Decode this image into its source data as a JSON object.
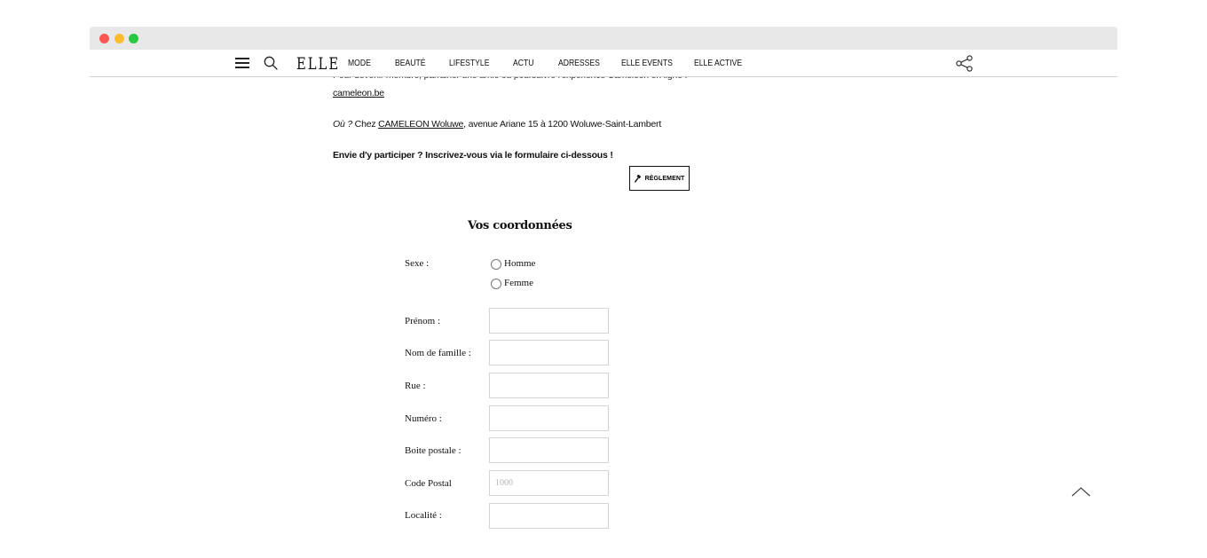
{
  "header": {
    "logo": "ELLE",
    "nav": [
      "MODE",
      "BEAUTÉ",
      "LIFESTYLE",
      "ACTU",
      "ADRESSES",
      "ELLE EVENTS",
      "ELLE ACTIVE"
    ]
  },
  "article": {
    "cut_line": "Pour devenir membre, parrainer une amie ou poursuivre l'expérience Cameleon en ligne :",
    "site_link": "cameleon.be",
    "where_label": "Où ?",
    "where_prefix": " Chez ",
    "where_link": "CAMELEON Woluwe",
    "where_rest": ", avenue Ariane 15 à 1200 Woluwe-Saint-Lambert",
    "cta": "Envie d'y participer ? Inscrivez-vous via le formulaire ci-dessous !",
    "rules_button": "RÈGLEMENT"
  },
  "form": {
    "title": "Vos coordonnées",
    "sex_label": "Sexe :",
    "options": [
      "Homme",
      "Femme"
    ],
    "fields": [
      {
        "label": "Prénom :",
        "value": "",
        "placeholder": ""
      },
      {
        "label": "Nom de famille :",
        "value": "",
        "placeholder": ""
      },
      {
        "label": "Rue :",
        "value": "",
        "placeholder": ""
      },
      {
        "label": "Numéro :",
        "value": "",
        "placeholder": ""
      },
      {
        "label": "Boite postale :",
        "value": "",
        "placeholder": ""
      },
      {
        "label": "Code Postal",
        "value": "",
        "placeholder": "1000"
      },
      {
        "label": "Localité :",
        "value": "",
        "placeholder": ""
      }
    ]
  },
  "icons": {
    "menu": "hamburger-icon",
    "search": "search-icon",
    "share": "share-icon",
    "rules": "gavel-icon",
    "back_to_top": "chevron-up-icon"
  },
  "colors": {
    "traffic_red": "#fd5753",
    "traffic_yellow": "#fdbc2e",
    "traffic_green": "#28c840",
    "chrome_bar": "#e8e8e8",
    "text": "#111111"
  }
}
